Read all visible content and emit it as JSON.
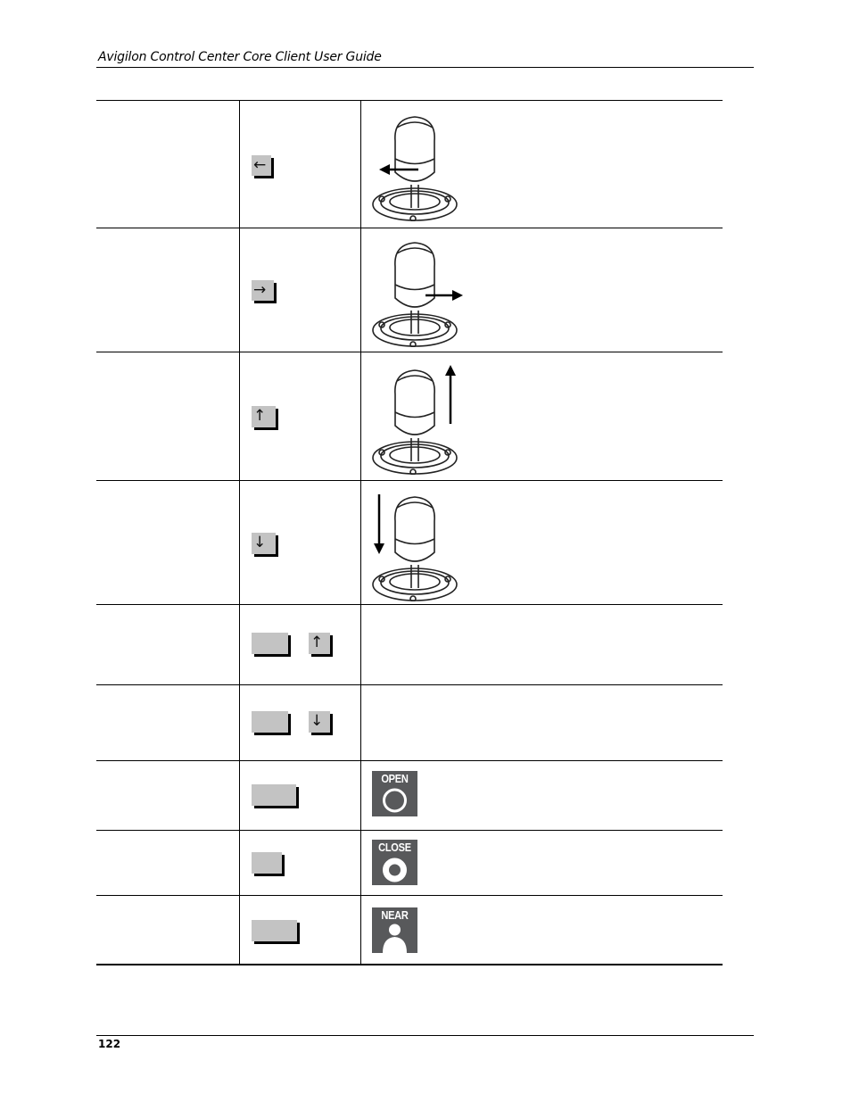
{
  "header": {
    "title": "Avigilon Control Center Core Client User Guide"
  },
  "footer": {
    "page_number": "122"
  },
  "table": {
    "rows": [
      {
        "keys": [
          "←"
        ],
        "image": "joystick-left",
        "arrow": "left"
      },
      {
        "keys": [
          "→"
        ],
        "image": "joystick-right",
        "arrow": "right"
      },
      {
        "keys": [
          "↑"
        ],
        "image": "joystick-tilt-up",
        "arrow": "up"
      },
      {
        "keys": [
          "↓"
        ],
        "image": "joystick-tilt-down",
        "arrow": "down"
      },
      {
        "keys": [
          "",
          "↑"
        ],
        "image": null
      },
      {
        "keys": [
          "",
          "↓"
        ],
        "image": null
      },
      {
        "keys": [
          ""
        ],
        "image": "iris-open-icon",
        "icon_label": "OPEN"
      },
      {
        "keys": [
          ""
        ],
        "image": "iris-close-icon",
        "icon_label": "CLOSE"
      },
      {
        "keys": [
          ""
        ],
        "image": "focus-near-icon",
        "icon_label": "NEAR"
      }
    ]
  },
  "colors": {
    "key_fill": "#c3c3c3",
    "icon_bg": "#58595b"
  }
}
